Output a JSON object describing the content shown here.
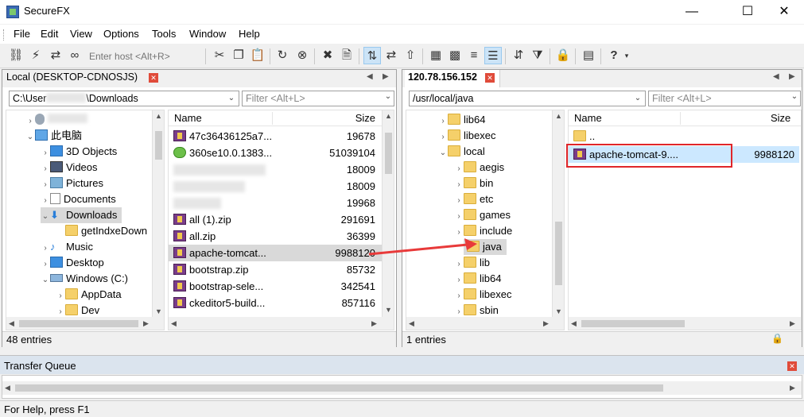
{
  "window": {
    "title": "SecureFX",
    "minimize": "—",
    "maximize": "☐",
    "close": "✕"
  },
  "menu": [
    "File",
    "Edit",
    "View",
    "Options",
    "Tools",
    "Window",
    "Help"
  ],
  "toolbar": {
    "host_placeholder": "Enter host <Alt+R>"
  },
  "local": {
    "tab_label": "Local (DESKTOP-CDNOSJS)",
    "path_prefix": "C:\\User",
    "path_suffix": "\\Downloads",
    "filter_placeholder": "Filter <Alt+L>",
    "tree": [
      {
        "label": "此电脑",
        "icon": "pc-icon",
        "chev": "⌄"
      },
      {
        "label": "3D Objects",
        "icon": "cube-icon",
        "chev": "›"
      },
      {
        "label": "Videos",
        "icon": "video-icon",
        "chev": "›"
      },
      {
        "label": "Pictures",
        "icon": "picture-icon",
        "chev": "›"
      },
      {
        "label": "Documents",
        "icon": "document-icon",
        "chev": "›"
      },
      {
        "label": "Downloads",
        "icon": "download-icon",
        "chev": "⌄"
      },
      {
        "label": "getIndxeDown",
        "icon": "folder-icon",
        "chev": ""
      },
      {
        "label": "Music",
        "icon": "music-icon",
        "chev": "›"
      },
      {
        "label": "Desktop",
        "icon": "desktop-icon",
        "chev": "›"
      },
      {
        "label": "Windows (C:)",
        "icon": "drive-icon",
        "chev": "⌄"
      },
      {
        "label": "AppData",
        "icon": "folder-icon",
        "chev": "›"
      },
      {
        "label": "Dev",
        "icon": "folder-icon",
        "chev": "›"
      }
    ],
    "columns": {
      "name": "Name",
      "size": "Size"
    },
    "files": [
      {
        "name": "47c36436125a7...",
        "size": "19678",
        "icon": "rar"
      },
      {
        "name": "360se10.0.1383...",
        "size": "51039104",
        "icon": "se360"
      },
      {
        "name": "",
        "size": "18009",
        "icon": "blur"
      },
      {
        "name": "",
        "size": "18009",
        "icon": "blur"
      },
      {
        "name": "",
        "size": "19968",
        "icon": "blur"
      },
      {
        "name": "all (1).zip",
        "size": "291691",
        "icon": "rar"
      },
      {
        "name": "all.zip",
        "size": "36399",
        "icon": "rar"
      },
      {
        "name": "apache-tomcat...",
        "size": "9988120",
        "icon": "rar"
      },
      {
        "name": "bootstrap.zip",
        "size": "85732",
        "icon": "rar"
      },
      {
        "name": "bootstrap-sele...",
        "size": "342541",
        "icon": "rar"
      },
      {
        "name": "ckeditor5-build...",
        "size": "857116",
        "icon": "rar"
      }
    ],
    "status": "48 entries"
  },
  "remote": {
    "tab_label": "120.78.156.152",
    "path": "/usr/local/java",
    "filter_placeholder": "Filter <Alt+L>",
    "tree": [
      {
        "label": "lib64",
        "chev": "›",
        "indent": 0
      },
      {
        "label": "libexec",
        "chev": "›",
        "indent": 0
      },
      {
        "label": "local",
        "chev": "⌄",
        "indent": 0
      },
      {
        "label": "aegis",
        "chev": "›",
        "indent": 1
      },
      {
        "label": "bin",
        "chev": "›",
        "indent": 1
      },
      {
        "label": "etc",
        "chev": "›",
        "indent": 1
      },
      {
        "label": "games",
        "chev": "›",
        "indent": 1
      },
      {
        "label": "include",
        "chev": "›",
        "indent": 1
      },
      {
        "label": "java",
        "chev": "",
        "indent": 1
      },
      {
        "label": "lib",
        "chev": "›",
        "indent": 1
      },
      {
        "label": "lib64",
        "chev": "›",
        "indent": 1
      },
      {
        "label": "libexec",
        "chev": "›",
        "indent": 1
      },
      {
        "label": "sbin",
        "chev": "›",
        "indent": 1
      }
    ],
    "columns": {
      "name": "Name",
      "size": "Size"
    },
    "files": [
      {
        "name": "..",
        "size": ""
      },
      {
        "name": "apache-tomcat-9....",
        "size": "9988120"
      }
    ],
    "status": "1 entries"
  },
  "transfer_queue": {
    "title": "Transfer Queue"
  },
  "statusbar": {
    "help": "For Help, press F1"
  },
  "colors": {
    "highlight_box": "#e0262a",
    "arrow": "#e83a3a",
    "selection": "#cce8ff"
  }
}
